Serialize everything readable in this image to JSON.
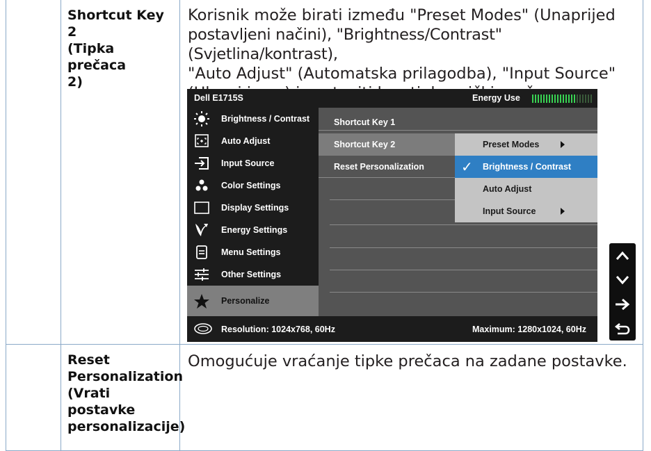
{
  "rows": [
    {
      "label_lines": [
        "Shortcut Key 2",
        "(Tipka prečaca",
        "2)"
      ],
      "desc_lines": [
        "Korisnik može birati između \"Preset Modes\" (Unaprijed",
        "postavljeni načini), \"Brightness/Contrast\" (Svjetlina/kontrast),",
        "\"Auto Adjust\" (Automatska prilagodba), \"Input Source\"",
        "(Ulazni izvor) i postaviti kao tipkovnički prečac."
      ]
    },
    {
      "label_lines": [
        "Reset",
        "Personalization",
        "(Vrati postavke",
        "personalizacije)"
      ],
      "desc_lines": [
        "Omogućuje vraćanje tipke prečaca na zadane postavke."
      ]
    }
  ],
  "osd": {
    "model": "Dell E1715S",
    "energy_label": "Energy Use",
    "energy_level": 0.72,
    "main_menu": [
      {
        "label": "Brightness / Contrast",
        "icon": "sun-icon"
      },
      {
        "label": "Auto Adjust",
        "icon": "auto-adjust-icon"
      },
      {
        "label": "Input Source",
        "icon": "input-source-icon"
      },
      {
        "label": "Color Settings",
        "icon": "color-dots-icon"
      },
      {
        "label": "Display Settings",
        "icon": "display-icon"
      },
      {
        "label": "Energy Settings",
        "icon": "leaf-icon"
      },
      {
        "label": "Menu Settings",
        "icon": "menu-icon"
      },
      {
        "label": "Other Settings",
        "icon": "sliders-icon"
      },
      {
        "label": "Personalize",
        "icon": "star-icon",
        "selected": true
      }
    ],
    "submenu": [
      "Shortcut Key 1",
      "Shortcut Key 2",
      "Reset Personalization"
    ],
    "submenu_selected": "Shortcut Key 2",
    "options": [
      {
        "label": "Preset Modes",
        "arrow": true
      },
      {
        "label": "Brightness / Contrast",
        "selected": true
      },
      {
        "label": "Auto Adjust"
      },
      {
        "label": "Input Source",
        "arrow": true
      }
    ],
    "resolution": "Resolution: 1024x768, 60Hz",
    "maximum": "Maximum: 1280x1024, 60Hz",
    "nav_buttons": [
      "up-arrow-icon",
      "down-arrow-icon",
      "right-arrow-icon",
      "back-arrow-icon"
    ],
    "colors": {
      "highlight": "#2f7fc4",
      "panel": "#1c1c1c",
      "submenu": "#545454",
      "options": "#c4c4c4",
      "energy_green": "#39d353"
    }
  }
}
